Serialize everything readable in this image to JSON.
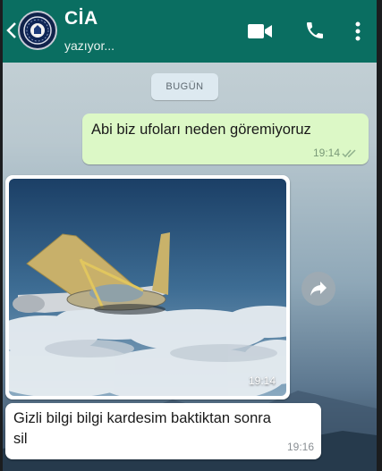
{
  "header": {
    "contact_name": "CİA",
    "status": "yazıyor...",
    "color": "#0a6e61",
    "icons": [
      "back-arrow-icon",
      "avatar",
      "video-call-icon",
      "phone-call-icon",
      "more-options-icon"
    ]
  },
  "chat": {
    "date_chip": "BUGÜN",
    "messages": [
      {
        "direction": "outgoing",
        "text": "Abi biz ufoları neden göremiyoruz",
        "time": "19:14",
        "status": "read"
      },
      {
        "direction": "incoming",
        "type": "image",
        "time": "19:14"
      },
      {
        "direction": "incoming",
        "text": "Gizli bilgi bilgi kardesim baktiktan sonra sil",
        "time": "19:16"
      }
    ]
  },
  "colors": {
    "outgoing_bubble": "#dcf8c6",
    "incoming_bubble": "#ffffff"
  }
}
